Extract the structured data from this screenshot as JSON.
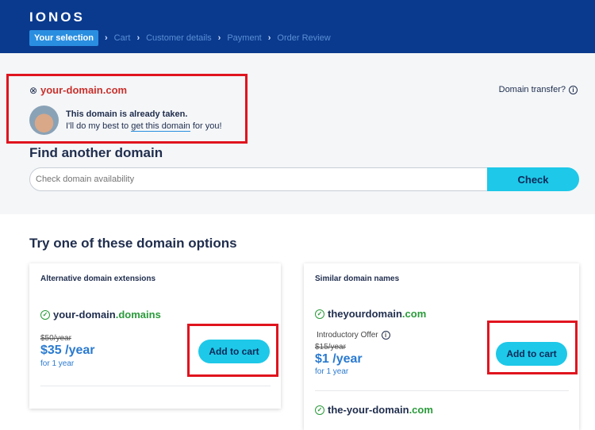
{
  "header": {
    "logo": "IONOS",
    "steps": [
      "Your selection",
      "Cart",
      "Customer details",
      "Payment",
      "Order Review"
    ],
    "separator": "›"
  },
  "taken": {
    "domain": "your-domain.com",
    "status_icon": "circle-x-icon",
    "message": "This domain is already taken.",
    "sub_before": "I'll do my best to ",
    "sub_link": "get this domain",
    "sub_after": " for you!",
    "transfer": "Domain transfer?"
  },
  "search": {
    "title": "Find another domain",
    "placeholder": "Check domain availability",
    "button": "Check"
  },
  "options": {
    "title": "Try one of these domain options",
    "alt": {
      "title": "Alternative domain extensions",
      "name": "your-domain",
      "tld": ".domains",
      "old_price": "$50/year",
      "price": "$35 /year",
      "term": "for 1 year",
      "button": "Add to cart"
    },
    "similar": {
      "title": "Similar domain names",
      "items": [
        {
          "name": "theyourdomain",
          "tld": ".com",
          "intro": "Introductory Offer",
          "old_price": "$15/year",
          "price": "$1 /year",
          "term": "for 1 year",
          "button": "Add to cart"
        },
        {
          "name": "the-your-domain",
          "tld": ".com"
        }
      ]
    }
  },
  "colors": {
    "header": "#0a3a8e",
    "accent": "#1ec8e8",
    "taken": "#c9302c",
    "available": "#2a9a3a",
    "highlight": "#e0141e"
  }
}
